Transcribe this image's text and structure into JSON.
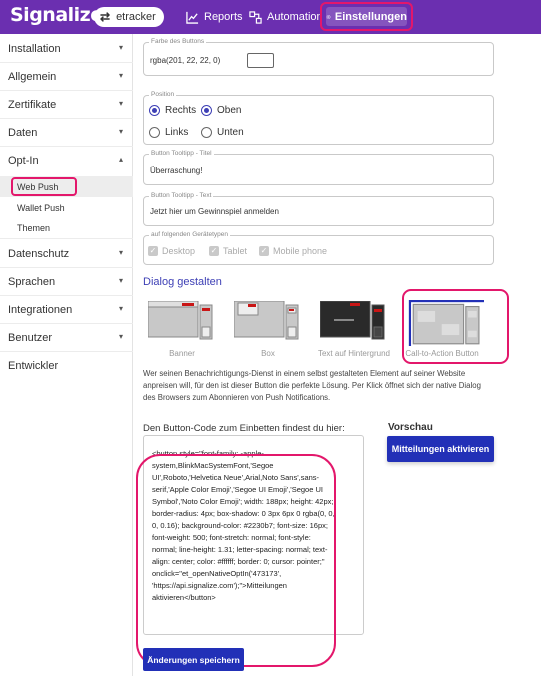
{
  "header": {
    "logo": "Signalize",
    "project": "etracker",
    "nav": [
      {
        "label": "Reports"
      },
      {
        "label": "Automation"
      },
      {
        "label": "Einstellungen"
      }
    ]
  },
  "sidebar": {
    "items": [
      {
        "label": "Installation"
      },
      {
        "label": "Allgemein"
      },
      {
        "label": "Zertifikate"
      },
      {
        "label": "Daten"
      },
      {
        "label": "Opt-In"
      },
      {
        "label": "Datenschutz"
      },
      {
        "label": "Sprachen"
      },
      {
        "label": "Integrationen"
      },
      {
        "label": "Benutzer"
      },
      {
        "label": "Entwickler"
      }
    ],
    "subitems": [
      {
        "label": "Web Push"
      },
      {
        "label": "Wallet Push"
      },
      {
        "label": "Themen"
      }
    ]
  },
  "form": {
    "button_color": {
      "legend": "Farbe des Buttons",
      "value": "rgba(201, 22, 22, 0)"
    },
    "position": {
      "legend": "Position",
      "options": [
        {
          "label": "Rechts",
          "checked": true
        },
        {
          "label": "Oben",
          "checked": true
        },
        {
          "label": "Links",
          "checked": false
        },
        {
          "label": "Unten",
          "checked": false
        }
      ]
    },
    "tooltip_title": {
      "legend": "Button Tooltipp - Titel",
      "value": "Überraschung!"
    },
    "tooltip_text": {
      "legend": "Button Tooltipp - Text",
      "value": "Jetzt hier um Gewinnspiel anmelden"
    },
    "devices": {
      "legend": "auf folgenden Gerätetypen",
      "options": [
        {
          "label": "Desktop",
          "checked": true
        },
        {
          "label": "Tablet",
          "checked": true
        },
        {
          "label": "Mobile phone",
          "checked": true
        }
      ]
    }
  },
  "dialog": {
    "title": "Dialog gestalten",
    "layouts": [
      {
        "label": "Banner"
      },
      {
        "label": "Box"
      },
      {
        "label": "Text auf Hintergrund"
      },
      {
        "label": "Call-to-Action Button"
      }
    ],
    "description": "Wer seinen Benachrichtigungs-Dienst in einem selbst gestalteten Element auf seiner Website anpreisen will, für den ist dieser Button die perfekte Lösung. Per Klick öffnet sich der native Dialog des Browsers zum Abonnieren von Push Notifications."
  },
  "code": {
    "heading": "Den Button-Code zum Einbetten findest du hier:",
    "snippet": "<button style=\"font-family: -apple-system,BlinkMacSystemFont,'Segoe UI',Roboto,'Helvetica Neue',Arial,Noto Sans',sans-serif,'Apple Color Emoji','Segoe UI Emoji','Segoe UI Symbol','Noto Color Emoji'; width: 188px; height: 42px; border-radius: 4px; box-shadow: 0 3px 6px 0 rgba(0, 0, 0, 0.16); background-color: #2230b7; font-size: 16px; font-weight: 500; font-stretch: normal; font-style: normal; line-height: 1.31; letter-spacing: normal; text-align: center; color: #ffffff; border: 0; cursor: pointer;\" onclick=\"et_openNativeOptIn('473173', 'https://api.signalize.com');\">Mitteilungen aktivieren</button>"
  },
  "preview": {
    "title": "Vorschau",
    "button_label": "Mitteilungen aktivieren"
  },
  "save_label": "Änderungen speichern",
  "colors": {
    "brand": "#6b2fb0",
    "primary_button": "#2230b7",
    "highlight": "#e3176b"
  }
}
